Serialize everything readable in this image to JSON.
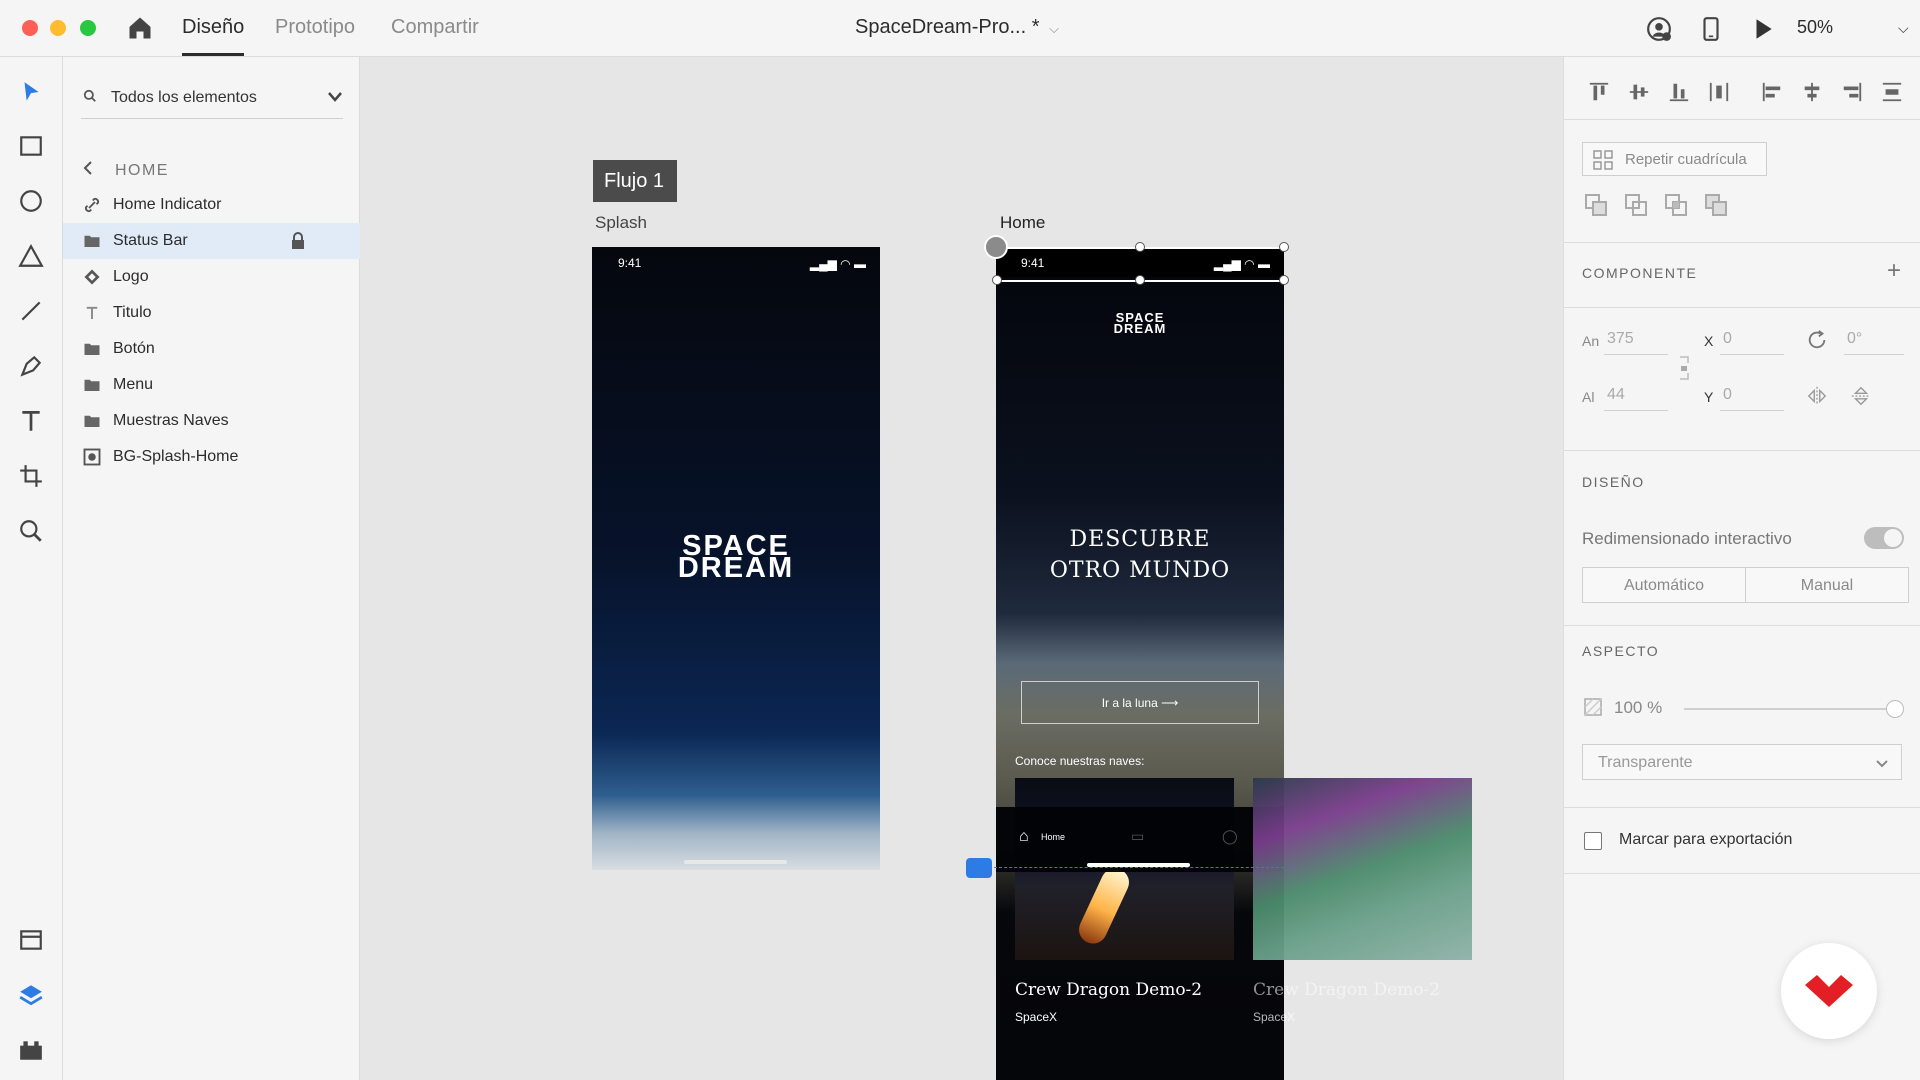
{
  "window": {
    "tabs": [
      "Diseño",
      "Prototipo",
      "Compartir"
    ],
    "document_title": "SpaceDream-Pro... *",
    "zoom": "50%"
  },
  "layers": {
    "filter_label": "Todos los elementos",
    "back_label": "HOME",
    "items": [
      {
        "label": "Home Indicator",
        "icon": "link-icon"
      },
      {
        "label": "Status Bar",
        "icon": "folder-icon",
        "selected": true,
        "locked": true
      },
      {
        "label": "Logo",
        "icon": "component-icon"
      },
      {
        "label": "Titulo",
        "icon": "text-icon"
      },
      {
        "label": "Botón",
        "icon": "folder-icon"
      },
      {
        "label": "Menu",
        "icon": "folder-icon"
      },
      {
        "label": "Muestras Naves",
        "icon": "folder-icon"
      },
      {
        "label": "BG-Splash-Home",
        "icon": "image-icon"
      }
    ]
  },
  "canvas": {
    "flow_tag": "Flujo 1",
    "splash": {
      "label": "Splash",
      "time": "9:41",
      "logo_line1": "SPACE",
      "logo_line2": "DREAM"
    },
    "home": {
      "label": "Home",
      "time": "9:41",
      "logo_line1": "SPACE",
      "logo_line2": "DREAM",
      "hero_line1": "DESCUBRE",
      "hero_line2": "OTRO MUNDO",
      "cta": "Ir a la luna ⟶",
      "section": "Conoce nuestras naves:",
      "tab_home": "Home",
      "ships": [
        {
          "title": "Crew Dragon Demo-2",
          "company": "SpaceX"
        },
        {
          "title": "Crew Dragon Demo-2",
          "company": "SpaceX"
        }
      ]
    }
  },
  "inspector": {
    "repeat_grid": "Repetir cuadrícula",
    "component_heading": "COMPONENTE",
    "width_label": "An",
    "width_value": "375",
    "height_label": "Al",
    "height_value": "44",
    "x_label": "X",
    "x_value": "0",
    "y_label": "Y",
    "y_value": "0",
    "rotation_value": "0°",
    "design_heading": "DISEÑO",
    "responsive_label": "Redimensionado interactivo",
    "seg_auto": "Automático",
    "seg_manual": "Manual",
    "appearance_heading": "ASPECTO",
    "opacity": "100 %",
    "blend_mode": "Transparente",
    "export_label": "Marcar para exportación"
  },
  "colors": {
    "accent": "#2d7be5",
    "brand_red": "#e31e24"
  }
}
